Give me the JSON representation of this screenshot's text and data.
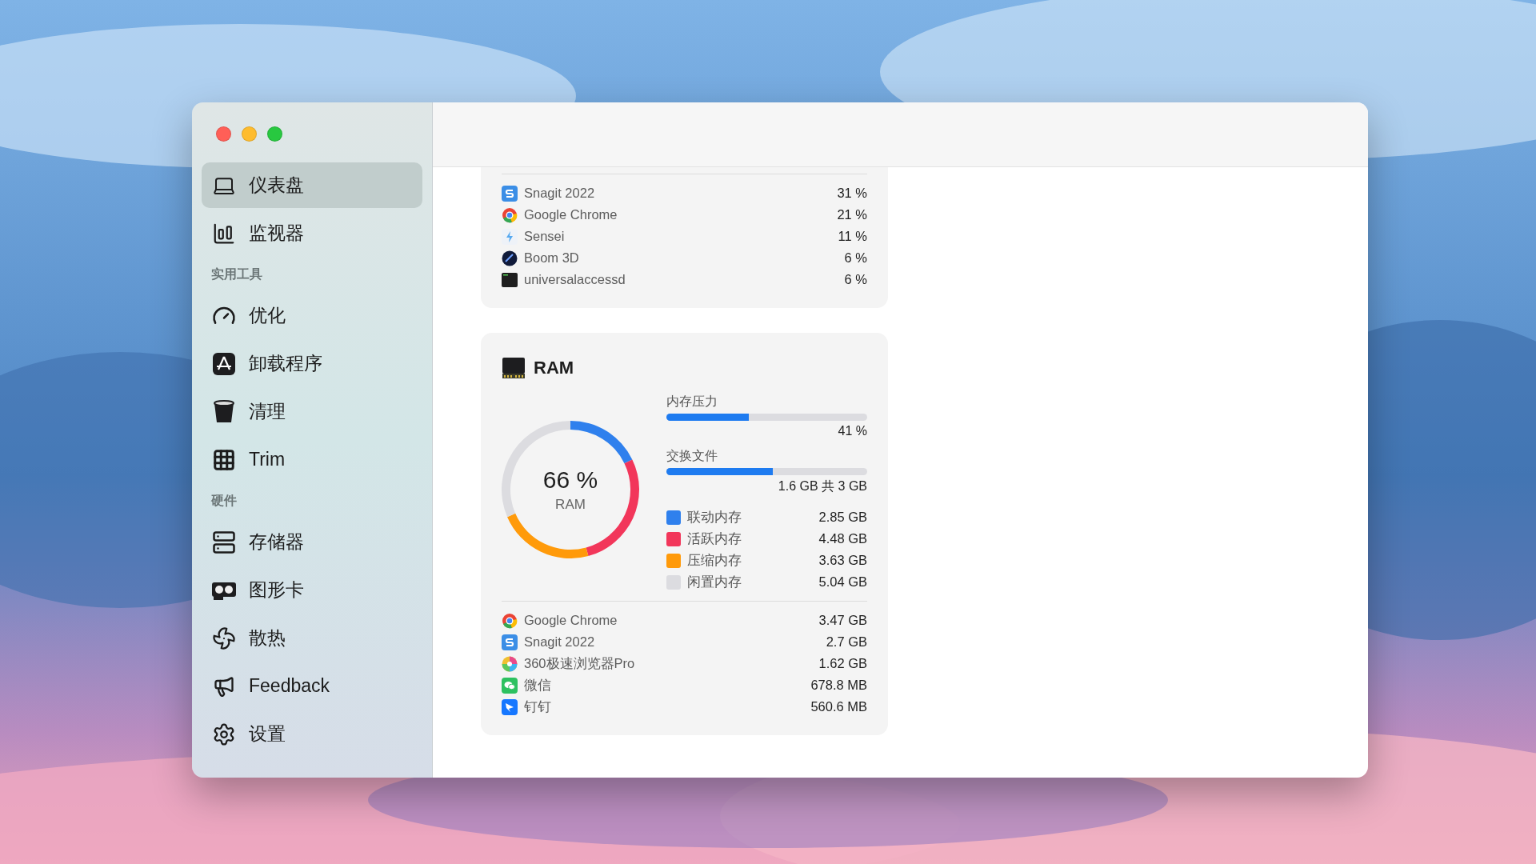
{
  "sidebar": {
    "items": [
      {
        "kind": "item",
        "label": "仪表盘",
        "selected": true
      },
      {
        "kind": "item",
        "label": "监视器",
        "selected": false
      },
      {
        "kind": "header",
        "label": "实用工具"
      },
      {
        "kind": "item",
        "label": "优化",
        "selected": false
      },
      {
        "kind": "item",
        "label": "卸载程序",
        "selected": false
      },
      {
        "kind": "item",
        "label": "清理",
        "selected": false
      },
      {
        "kind": "item",
        "label": "Trim",
        "selected": false
      },
      {
        "kind": "header",
        "label": "硬件"
      },
      {
        "kind": "item",
        "label": "存储器",
        "selected": false
      },
      {
        "kind": "item",
        "label": "图形卡",
        "selected": false
      },
      {
        "kind": "item",
        "label": "散热",
        "selected": false
      },
      {
        "kind": "item",
        "label": "Feedback",
        "selected": false
      },
      {
        "kind": "item",
        "label": "设置",
        "selected": false
      }
    ]
  },
  "cpu_card": {
    "processes": [
      {
        "name": "Snagit 2022",
        "value": "31 %"
      },
      {
        "name": "Google Chrome",
        "value": "21 %"
      },
      {
        "name": "Sensei",
        "value": "11 %"
      },
      {
        "name": "Boom 3D",
        "value": "6 %"
      },
      {
        "name": "universalaccessd",
        "value": "6 %"
      }
    ]
  },
  "ram_card": {
    "title": "RAM",
    "gauge": {
      "value": "66 %",
      "label": "RAM"
    },
    "chart_data": {
      "type": "donut",
      "values": [
        17.8,
        28.0,
        22.7,
        31.5
      ]
    },
    "meters": [
      {
        "label": "内存压力",
        "level": 0.41,
        "reading": "41 %"
      },
      {
        "label": "交换文件",
        "level": 0.53,
        "reading": "1.6 GB 共 3 GB"
      }
    ],
    "legend": [
      {
        "label": "联动内存",
        "value": "2.85 GB",
        "color": "#2f80ed"
      },
      {
        "label": "活跃内存",
        "value": "4.48 GB",
        "color": "#f2365a"
      },
      {
        "label": "压缩内存",
        "value": "3.63 GB",
        "color": "#ff9a0a"
      },
      {
        "label": "闲置内存",
        "value": "5.04 GB",
        "color": "#dcdce0"
      }
    ],
    "processes": [
      {
        "name": "Google Chrome",
        "value": "3.47 GB"
      },
      {
        "name": "Snagit 2022",
        "value": "2.7 GB"
      },
      {
        "name": "360极速浏览器Pro",
        "value": "1.62 GB"
      },
      {
        "name": "微信",
        "value": "678.8 MB"
      },
      {
        "name": "钉钉",
        "value": "560.6 MB"
      }
    ]
  }
}
